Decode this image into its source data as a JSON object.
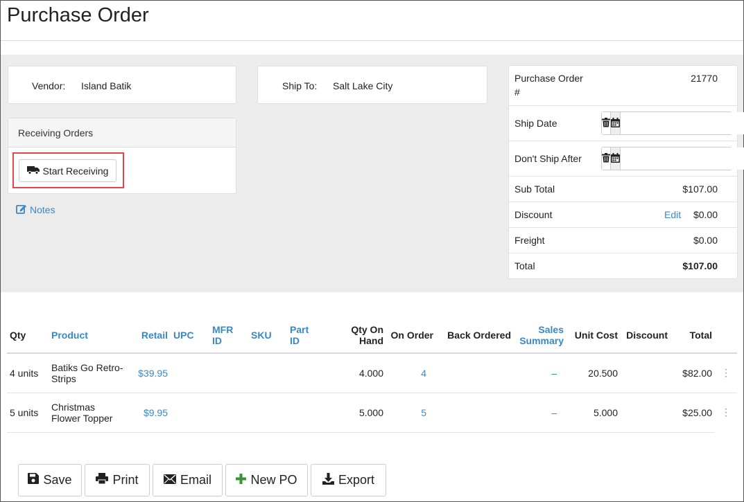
{
  "page": {
    "title": "Purchase Order"
  },
  "vendor": {
    "label": "Vendor:",
    "value": "Island Batik"
  },
  "ship_to": {
    "label": "Ship To:",
    "value": "Salt Lake City"
  },
  "receiving": {
    "heading": "Receiving Orders",
    "start_label": "Start Receiving"
  },
  "notes": {
    "label": "Notes"
  },
  "summary": {
    "po_label_line1": "Purchase Order",
    "po_label_line2": "#",
    "po_number": "21770",
    "ship_date_label": "Ship Date",
    "ship_date_value": "",
    "dont_ship_label": "Don't Ship After",
    "dont_ship_value": "",
    "subtotal_label": "Sub Total",
    "subtotal_value": "$107.00",
    "discount_label": "Discount",
    "discount_edit": "Edit",
    "discount_value": "$0.00",
    "freight_label": "Freight",
    "freight_value": "$0.00",
    "total_label": "Total",
    "total_value": "$107.00"
  },
  "table": {
    "headers": {
      "qty": "Qty",
      "product": "Product",
      "retail": "Retail",
      "upc": "UPC",
      "mfr_id_1": "MFR",
      "mfr_id_2": "ID",
      "sku": "SKU",
      "part_id_1": "Part",
      "part_id_2": "ID",
      "qty_on_hand": "Qty On Hand",
      "on_order": "On Order",
      "back_ordered": "Back Ordered",
      "sales_summary_1": "Sales",
      "sales_summary_2": "Summary",
      "unit_cost": "Unit Cost",
      "discount": "Discount",
      "total": "Total"
    },
    "rows": [
      {
        "qty": "4 units",
        "product_1": "Batiks Go Retro-",
        "product_2": "Strips",
        "retail": "$39.95",
        "upc": "",
        "mfr_id": "",
        "sku": "",
        "part_id": "",
        "qty_on_hand": "4.000",
        "on_order": "4",
        "back_ordered": "",
        "sales_summary": "–",
        "unit_cost": "20.500",
        "discount": "",
        "total": "$82.00"
      },
      {
        "qty": "5 units",
        "product_1": "Christmas",
        "product_2": "Flower Topper",
        "retail": "$9.95",
        "upc": "",
        "mfr_id": "",
        "sku": "",
        "part_id": "",
        "qty_on_hand": "5.000",
        "on_order": "5",
        "back_ordered": "",
        "sales_summary": "–",
        "unit_cost": "5.000",
        "discount": "",
        "total": "$25.00"
      }
    ]
  },
  "footer": {
    "save": "Save",
    "print": "Print",
    "email": "Email",
    "new_po": "New PO",
    "export": "Export"
  },
  "colors": {
    "link": "#3a87c5",
    "highlight": "#e0474c",
    "new_icon": "#3c8f3c"
  },
  "icons": [
    "truck-icon",
    "edit-icon",
    "trash-icon",
    "calendar-icon",
    "save-icon",
    "print-icon",
    "envelope-icon",
    "plus-icon",
    "download-icon",
    "vertical-dots-icon"
  ]
}
